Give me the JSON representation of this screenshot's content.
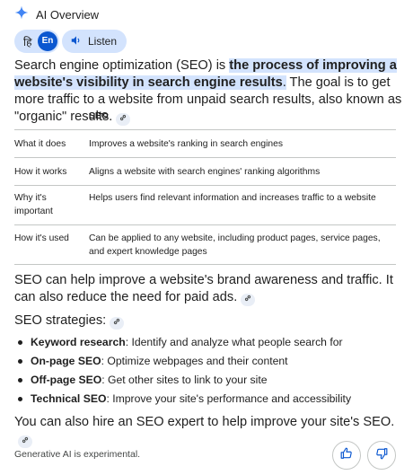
{
  "header": {
    "title": "AI Overview",
    "icon": "sparkle-icon",
    "accent": "#0b57d0"
  },
  "language": {
    "hindi_label": "हि",
    "english_label": "En"
  },
  "listen": {
    "label": "Listen"
  },
  "intro": {
    "part1": "Search engine optimization (SEO) is ",
    "highlight": "the process of improving a website's visibility in search engine results",
    "part2": ". The goal is to get more traffic to a website from unpaid search results, also known as \"organic\" results."
  },
  "table": {
    "header": [
      "",
      "SEO"
    ],
    "rows": [
      {
        "label": "What it does",
        "value": "Improves a website's ranking in search engines"
      },
      {
        "label": "How it works",
        "value": "Aligns a website with search engines' ranking algorithms"
      },
      {
        "label": "Why it's important",
        "value": "Helps users find relevant information and increases traffic to a website"
      },
      {
        "label": "How it's used",
        "value": "Can be applied to any website, including product pages, service pages, and expert knowledge pages"
      }
    ]
  },
  "paragraph2": "SEO can help improve a website's brand awareness and traffic. It can also reduce the need for paid ads.",
  "strategies": {
    "heading": "SEO strategies:",
    "items": [
      {
        "term": "Keyword research",
        "desc": ": Identify and analyze what people search for"
      },
      {
        "term": "On-page SEO",
        "desc": ": Optimize webpages and their content"
      },
      {
        "term": "Off-page SEO",
        "desc": ": Get other sites to link to your site"
      },
      {
        "term": "Technical SEO",
        "desc": ": Improve your site's performance and accessibility"
      }
    ]
  },
  "paragraph3": "You can also hire an SEO expert to help improve your site's SEO.",
  "footer": {
    "note": "Generative AI is experimental."
  }
}
